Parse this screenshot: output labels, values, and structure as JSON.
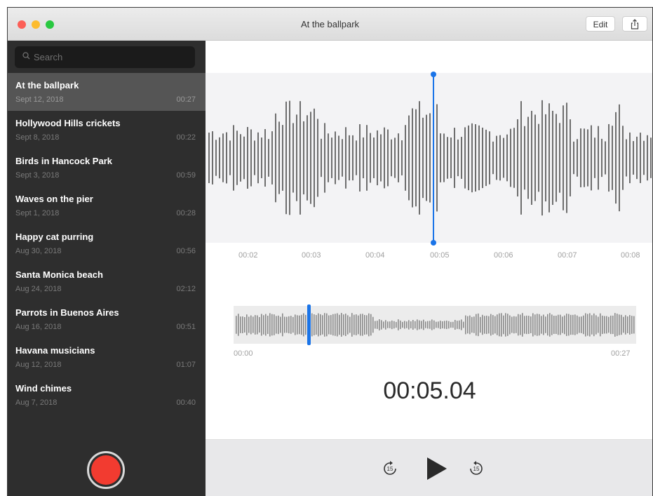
{
  "window": {
    "title": "At the ballpark",
    "edit_label": "Edit",
    "share_icon": "share-icon"
  },
  "search": {
    "placeholder": "Search",
    "icon": "search-icon"
  },
  "recordings": [
    {
      "title": "At the ballpark",
      "date": "Sept 12, 2018",
      "duration": "00:27",
      "selected": true
    },
    {
      "title": "Hollywood Hills crickets",
      "date": "Sept 8, 2018",
      "duration": "00:22"
    },
    {
      "title": "Birds in Hancock Park",
      "date": "Sept 3, 2018",
      "duration": "00:59"
    },
    {
      "title": "Waves on the pier",
      "date": "Sept 1, 2018",
      "duration": "00:28"
    },
    {
      "title": "Happy cat purring",
      "date": "Aug 30, 2018",
      "duration": "00:56"
    },
    {
      "title": "Santa Monica beach",
      "date": "Aug 24, 2018",
      "duration": "02:12"
    },
    {
      "title": "Parrots in Buenos Aires",
      "date": "Aug 16, 2018",
      "duration": "00:51"
    },
    {
      "title": "Havana musicians",
      "date": "Aug 12, 2018",
      "duration": "01:07"
    },
    {
      "title": "Wind chimes",
      "date": "Aug 7, 2018",
      "duration": "00:40"
    }
  ],
  "timeline": {
    "ticks": [
      "00:02",
      "00:03",
      "00:04",
      "00:05",
      "00:06",
      "00:07",
      "00:08"
    ],
    "overview_start": "00:00",
    "overview_end": "00:27",
    "playhead_seconds": 5.04,
    "total_seconds": 27
  },
  "player": {
    "elapsed": "00:05.04",
    "skip_back_label": "15",
    "skip_forward_label": "15"
  },
  "colors": {
    "accent": "#1a74e8",
    "record": "#f23b30",
    "sidebar": "#2e2e2e",
    "selected_row": "#555555",
    "waveform": "#6e6e6e"
  }
}
